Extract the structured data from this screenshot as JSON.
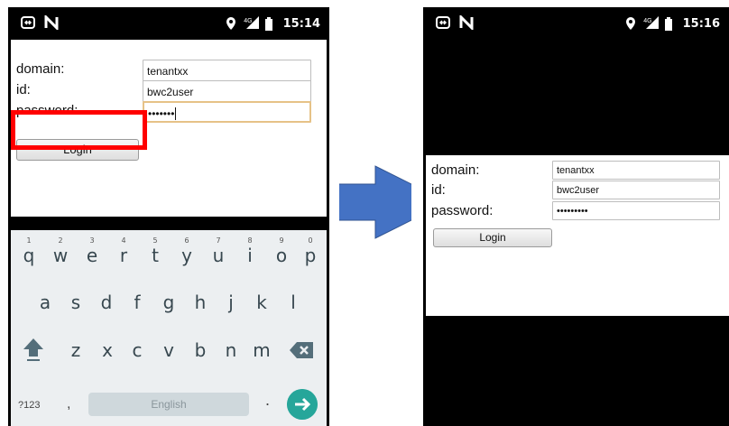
{
  "before_screen": {
    "status_bar": {
      "time": "15:14",
      "network": "4G"
    },
    "form": {
      "domain_label": "domain:",
      "domain_value": "tenantxx",
      "id_label": "id:",
      "id_value": "bwc2user",
      "password_label": "password:",
      "password_value": "•••••••",
      "login_label": "Login"
    },
    "keyboard": {
      "row1": [
        {
          "key": "q",
          "hint": "1"
        },
        {
          "key": "w",
          "hint": "2"
        },
        {
          "key": "e",
          "hint": "3"
        },
        {
          "key": "r",
          "hint": "4"
        },
        {
          "key": "t",
          "hint": "5"
        },
        {
          "key": "y",
          "hint": "6"
        },
        {
          "key": "u",
          "hint": "7"
        },
        {
          "key": "i",
          "hint": "8"
        },
        {
          "key": "o",
          "hint": "9"
        },
        {
          "key": "p",
          "hint": "0"
        }
      ],
      "row2": [
        "a",
        "s",
        "d",
        "f",
        "g",
        "h",
        "j",
        "k",
        "l"
      ],
      "row3": [
        "z",
        "x",
        "c",
        "v",
        "b",
        "n",
        "m"
      ],
      "symbols_label": "?123",
      "comma_label": ",",
      "space_label": "English",
      "period_label": "."
    }
  },
  "after_screen": {
    "status_bar": {
      "time": "15:16",
      "network": "4G"
    },
    "form": {
      "domain_label": "domain:",
      "domain_value": "tenantxx",
      "id_label": "id:",
      "id_value": "bwc2user",
      "password_label": "password:",
      "password_value": "•••••••••",
      "login_label": "Login"
    }
  },
  "colors": {
    "highlight": "#ff0000",
    "arrow": "#4472c4",
    "enter_key": "#26a69a",
    "focus_border": "#e6c287"
  },
  "icons": [
    "screen-cast-icon",
    "n-notification-icon",
    "location-pin-icon",
    "cellular-signal-icon",
    "battery-icon",
    "shift-icon",
    "backspace-icon",
    "enter-arrow-icon"
  ]
}
